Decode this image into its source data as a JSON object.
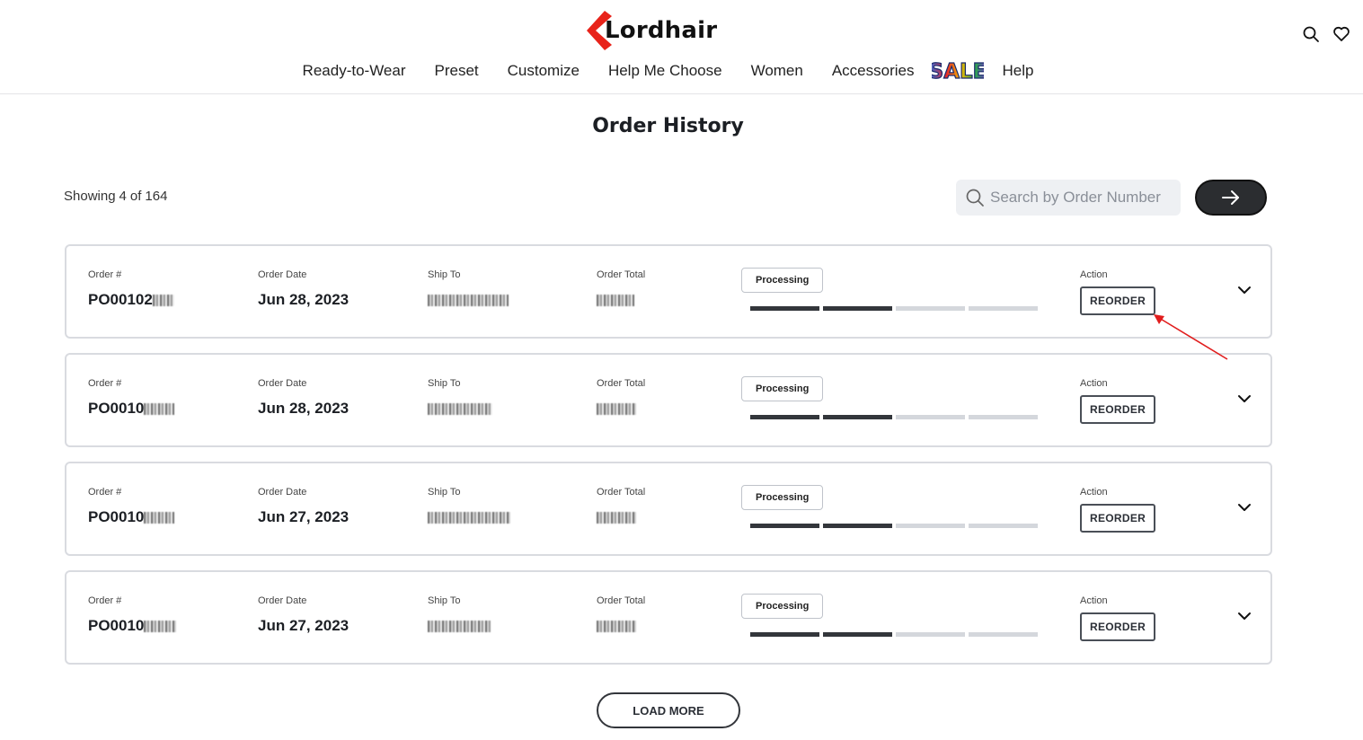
{
  "header": {
    "logo_text": "Lordhair",
    "nav": [
      {
        "label": "Ready-to-Wear"
      },
      {
        "label": "Preset"
      },
      {
        "label": "Customize"
      },
      {
        "label": "Help Me Choose"
      },
      {
        "label": "Women"
      },
      {
        "label": "Accessories"
      },
      {
        "label": "Help"
      }
    ],
    "sale_badge": "SALE",
    "icons": [
      "search-icon",
      "heart-icon"
    ]
  },
  "page": {
    "title": "Order History",
    "showing_prefix": "Showing",
    "showing_count": "4",
    "showing_of": "of",
    "showing_total": "164",
    "search_placeholder": "Search by Order Number",
    "load_more_label": "LOAD MORE"
  },
  "labels": {
    "order_num": "Order #",
    "order_date": "Order Date",
    "ship_to": "Ship To",
    "order_total": "Order Total",
    "action": "Action",
    "reorder": "REORDER"
  },
  "orders": [
    {
      "order_prefix": "PO00102",
      "date": "Jun 28, 2023",
      "status": "Processing",
      "progress_steps_done": 2,
      "progress_steps_total": 4
    },
    {
      "order_prefix": "PO0010",
      "date": "Jun 28, 2023",
      "status": "Processing",
      "progress_steps_done": 2,
      "progress_steps_total": 4
    },
    {
      "order_prefix": "PO0010",
      "date": "Jun 27, 2023",
      "status": "Processing",
      "progress_steps_done": 2,
      "progress_steps_total": 4
    },
    {
      "order_prefix": "PO0010",
      "date": "Jun 27, 2023",
      "status": "Processing",
      "progress_steps_done": 2,
      "progress_steps_total": 4
    }
  ],
  "colors": {
    "logo_accent": "#e8231a",
    "dark_button": "#2b2d30",
    "progress_done": "#33363b",
    "progress_pending": "#d4d7dc",
    "annotation_arrow": "#e11d1d"
  }
}
